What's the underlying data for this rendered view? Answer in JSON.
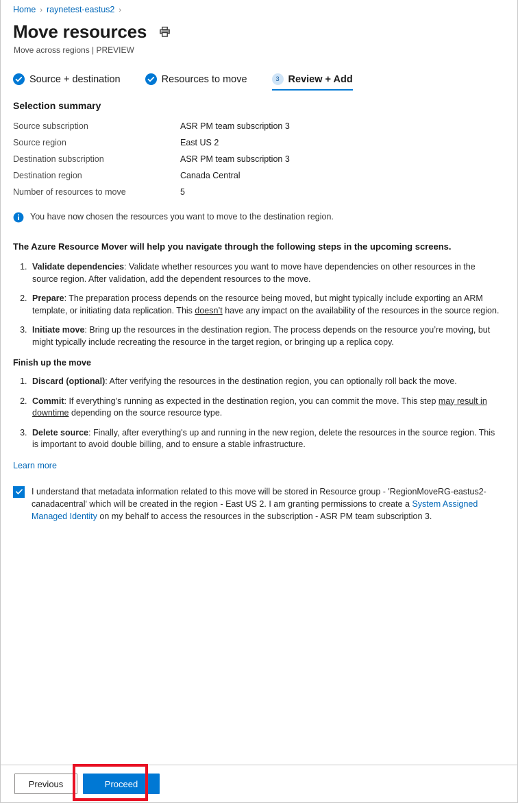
{
  "breadcrumb": {
    "items": [
      {
        "label": "Home"
      },
      {
        "label": "raynetest-eastus2"
      }
    ],
    "separator": "›"
  },
  "header": {
    "title": "Move resources",
    "subtitle": "Move across regions | PREVIEW",
    "print_icon": "printer-icon"
  },
  "wizard": {
    "tabs": [
      {
        "label": "Source + destination",
        "state": "completed",
        "icon": "check-circle-icon"
      },
      {
        "label": "Resources to move",
        "state": "completed",
        "icon": "check-circle-icon"
      },
      {
        "label": "Review + Add",
        "state": "active",
        "step": "3"
      }
    ]
  },
  "summary": {
    "heading": "Selection summary",
    "rows": [
      {
        "key": "Source subscription",
        "value": "ASR PM team subscription 3"
      },
      {
        "key": "Source region",
        "value": "East US 2"
      },
      {
        "key": "Destination subscription",
        "value": "ASR PM team subscription 3"
      },
      {
        "key": "Destination region",
        "value": "Canada Central"
      },
      {
        "key": "Number of resources to move",
        "value": "5"
      }
    ]
  },
  "info": {
    "icon": "info-circle-icon",
    "text": "You have now chosen the resources you want to move to the destination region."
  },
  "guidance": {
    "lead": "The Azure Resource Mover will help you navigate through the following steps in the upcoming screens.",
    "steps": [
      {
        "term": "Validate dependencies",
        "sep": ": ",
        "text_before": "Validate whether resources you want to move have dependencies on other resources in the source region. After validation, add the dependent resources to the move.",
        "underlined": "",
        "text_after": ""
      },
      {
        "term": "Prepare",
        "sep": ": ",
        "text_before": "The preparation process depends on the resource being moved, but might typically include exporting an ARM template, or initiating data replication. This ",
        "underlined": "doesn’t",
        "text_after": " have any impact on the availability of the resources in the source region."
      },
      {
        "term": "Initiate move",
        "sep": ": ",
        "text_before": "Bring up the resources in the destination region. The process depends on the resource you’re moving, but might typically include recreating the resource in the target region, or bringing up a replica copy.",
        "underlined": "",
        "text_after": ""
      }
    ],
    "finish_heading": "Finish up the move",
    "finish_steps": [
      {
        "term": "Discard (optional)",
        "sep": ": ",
        "text_before": "After verifying the resources in the destination region, you can optionally roll back the move.",
        "underlined": "",
        "text_after": ""
      },
      {
        "term": "Commit",
        "sep": ": ",
        "text_before": "If everything’s running as expected in the destination region, you can commit the move. This step ",
        "underlined": "may result in downtime",
        "text_after": " depending on the source resource type."
      },
      {
        "term": "Delete source",
        "sep": ": ",
        "text_before": "Finally, after everything's up and running in the new region, delete the resources in the source region. This is important to avoid double billing, and to ensure a stable infrastructure.",
        "underlined": "",
        "text_after": ""
      }
    ],
    "learn_more": "Learn more"
  },
  "consent": {
    "checked": true,
    "text_part1": "I understand that metadata information related to this move will be stored in Resource group - 'RegionMoveRG-eastus2-canadacentral' which will be created in the region - East US 2. I am granting permissions to create a ",
    "link_text": "System Assigned Managed Identity",
    "text_part2": " on my behalf to access the resources in the subscription - ASR PM team subscription 3."
  },
  "footer": {
    "previous_label": "Previous",
    "proceed_label": "Proceed"
  },
  "colors": {
    "accent": "#0078d4",
    "link": "#0067b8",
    "highlight": "#e81123",
    "step_badge_bg": "#cfe4f7"
  }
}
